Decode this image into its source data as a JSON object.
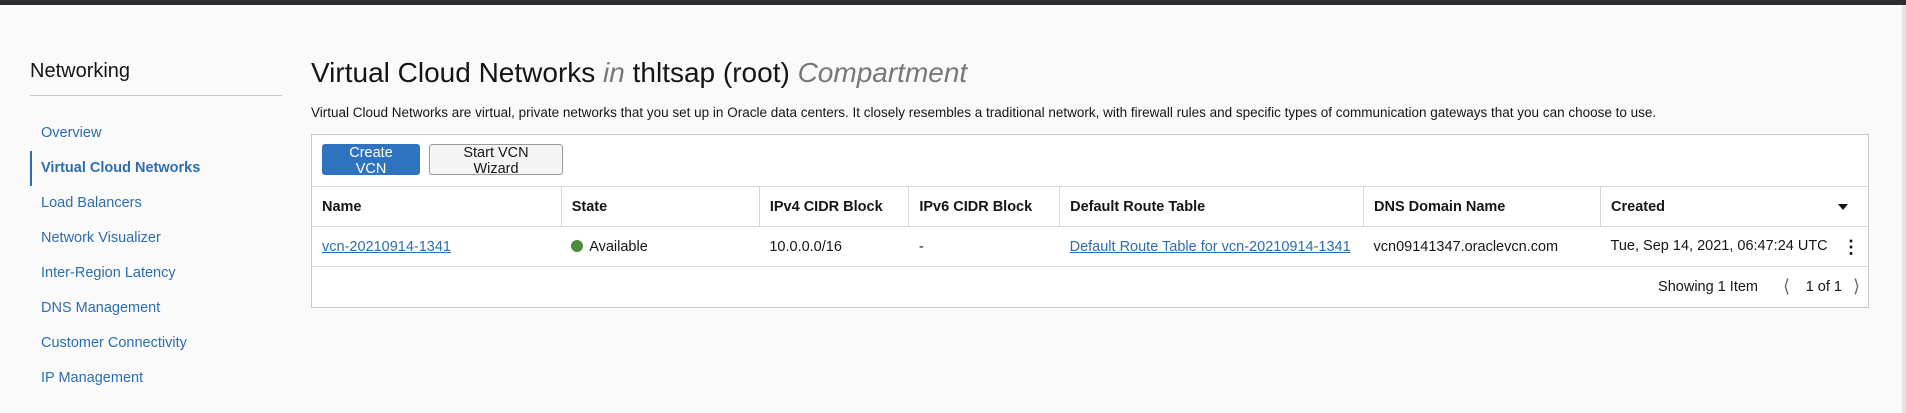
{
  "sidebar": {
    "title": "Networking",
    "items": [
      {
        "label": "Overview"
      },
      {
        "label": "Virtual Cloud Networks"
      },
      {
        "label": "Load Balancers"
      },
      {
        "label": "Network Visualizer"
      },
      {
        "label": "Inter-Region Latency"
      },
      {
        "label": "DNS Management"
      },
      {
        "label": "Customer Connectivity"
      },
      {
        "label": "IP Management"
      }
    ],
    "active_item": "Virtual Cloud Networks"
  },
  "page": {
    "title_main": "Virtual Cloud Networks",
    "title_in": "in",
    "title_compartment": "thltsap (root)",
    "title_suffix": "Compartment",
    "description": "Virtual Cloud Networks are virtual, private networks that you set up in Oracle data centers. It closely resembles a traditional network, with firewall rules and specific types of communication gateways that you can choose to use."
  },
  "toolbar": {
    "create_label": "Create VCN",
    "wizard_label": "Start VCN Wizard"
  },
  "table": {
    "columns": [
      "Name",
      "State",
      "IPv4 CIDR Block",
      "IPv6 CIDR Block",
      "Default Route Table",
      "DNS Domain Name",
      "Created"
    ],
    "rows": [
      {
        "name": "vcn-20210914-1341",
        "state": "Available",
        "ipv4": "10.0.0.0/16",
        "ipv6": "-",
        "route_table": "Default Route Table for vcn-20210914-1341",
        "dns": "vcn09141347.oraclevcn.com",
        "created": "Tue, Sep 14, 2021, 06:47:24 UTC"
      }
    ]
  },
  "footer": {
    "showing": "Showing 1 Item",
    "page_count": "1 of 1"
  },
  "colors": {
    "accent": "#2e73bf",
    "link": "#2c6db0",
    "available": "#4e8b3a"
  },
  "icons": {
    "sort": "caret-down-icon",
    "actions": "kebab-menu-icon",
    "prev": "chevron-left-icon",
    "next": "chevron-right-icon",
    "state": "status-dot-icon"
  }
}
